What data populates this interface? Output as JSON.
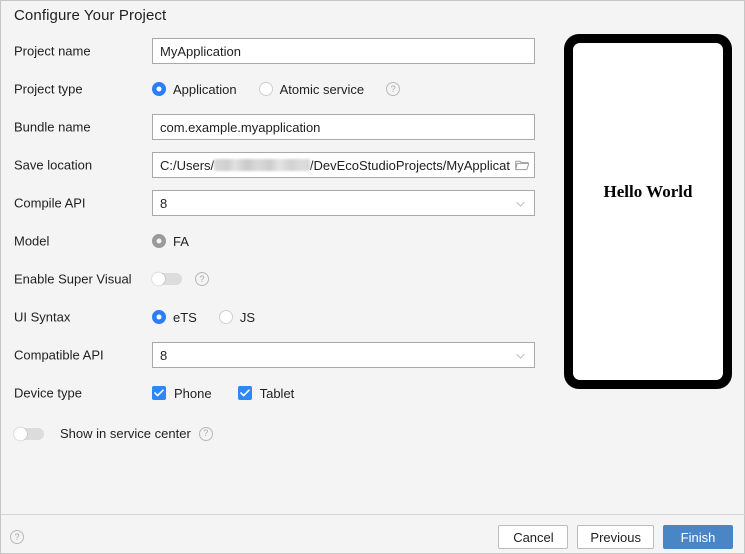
{
  "dialog": {
    "title": "Configure Your Project"
  },
  "fields": {
    "project_name": {
      "label": "Project name",
      "value": "MyApplication"
    },
    "project_type": {
      "label": "Project type",
      "options": [
        {
          "label": "Application",
          "selected": true
        },
        {
          "label": "Atomic service",
          "selected": false
        }
      ],
      "help": "?"
    },
    "bundle_name": {
      "label": "Bundle name",
      "value": "com.example.myapplication"
    },
    "save_location": {
      "label": "Save location",
      "value_prefix": "C:/Users/",
      "value_suffix": "/DevEcoStudioProjects/MyApplicat",
      "redacted": true,
      "browse_icon": "folder-icon"
    },
    "compile_api": {
      "label": "Compile API",
      "value": "8"
    },
    "model": {
      "label": "Model",
      "options": [
        {
          "label": "FA",
          "selected": true,
          "disabled": true
        }
      ]
    },
    "enable_super_visual": {
      "label": "Enable Super Visual",
      "on": false,
      "help": "?"
    },
    "ui_syntax": {
      "label": "UI Syntax",
      "options": [
        {
          "label": "eTS",
          "selected": true
        },
        {
          "label": "JS",
          "selected": false
        }
      ]
    },
    "compatible_api": {
      "label": "Compatible API",
      "value": "8"
    },
    "device_type": {
      "label": "Device type",
      "options": [
        {
          "label": "Phone",
          "checked": true
        },
        {
          "label": "Tablet",
          "checked": true
        }
      ]
    },
    "show_in_service_center": {
      "label": "Show in service center",
      "on": false,
      "help": "?"
    }
  },
  "preview": {
    "text": "Hello World"
  },
  "footer": {
    "help": "?",
    "cancel": "Cancel",
    "previous": "Previous",
    "finish": "Finish"
  },
  "colors": {
    "accent_blue": "#2c7ef8",
    "checkbox_blue": "#2c87f8",
    "primary_button": "#4a86c5",
    "background": "#f4f4f4"
  }
}
